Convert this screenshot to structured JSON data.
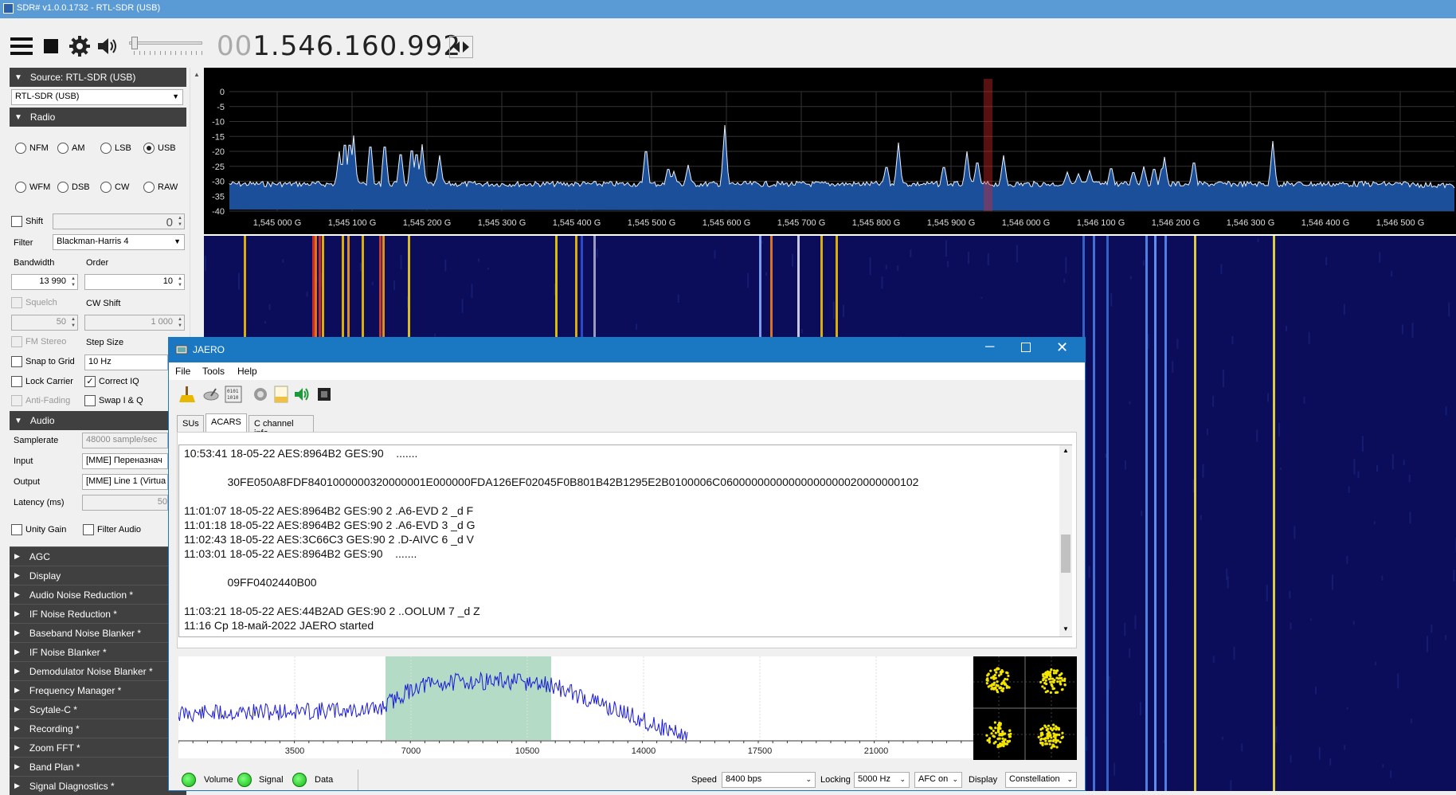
{
  "titlebar": {
    "title": "SDR# v1.0.0.1732 - RTL-SDR (USB)"
  },
  "toolbar": {
    "freq_dim": "00",
    "freq_main": "1.546.160.992"
  },
  "source": {
    "header": "Source: RTL-SDR (USB)",
    "device": "RTL-SDR (USB)"
  },
  "radio": {
    "header": "Radio",
    "modes": [
      "NFM",
      "AM",
      "LSB",
      "USB",
      "WFM",
      "DSB",
      "CW",
      "RAW"
    ],
    "selected_mode": "USB",
    "shift_label": "Shift",
    "shift_value": "0",
    "filter_label": "Filter",
    "filter_value": "Blackman-Harris 4",
    "bandwidth_label": "Bandwidth",
    "bandwidth_value": "13 990",
    "order_label": "Order",
    "order_value": "10",
    "squelch_label": "Squelch",
    "squelch_value": "50",
    "cwshift_label": "CW Shift",
    "cwshift_value": "1 000",
    "fmstereo_label": "FM Stereo",
    "stepsize_label": "Step Size",
    "snap_label": "Snap to Grid",
    "step_value": "10 Hz",
    "lockcarrier_label": "Lock Carrier",
    "correctiq_label": "Correct IQ",
    "antifading_label": "Anti-Fading",
    "swapiq_label": "Swap I & Q"
  },
  "audio": {
    "header": "Audio",
    "samplerate_label": "Samplerate",
    "samplerate_value": "48000 sample/sec",
    "input_label": "Input",
    "input_value": "[MME] Переназнач",
    "output_label": "Output",
    "output_value": "[MME] Line 1 (Virtua",
    "latency_label": "Latency (ms)",
    "latency_value": "50",
    "unitygain_label": "Unity Gain",
    "filteraudio_label": "Filter Audio"
  },
  "plugins": [
    "AGC",
    "Display",
    "Audio Noise Reduction *",
    "IF Noise Reduction *",
    "Baseband Noise Blanker *",
    "IF Noise Blanker *",
    "Demodulator Noise Blanker *",
    "Frequency Manager *",
    "Scytale-C *",
    "Recording *",
    "Zoom FFT *",
    "Band Plan *",
    "Signal Diagnostics *"
  ],
  "spectrum": {
    "y_ticks": [
      "0",
      "-5",
      "-10",
      "-15",
      "-20",
      "-25",
      "-30",
      "-35",
      "-40"
    ],
    "x_ticks": [
      "1,545 000 G",
      "1,545 100 G",
      "1,545 200 G",
      "1,545 300 G",
      "1,545 400 G",
      "1,545 500 G",
      "1,545 600 G",
      "1,545 700 G",
      "1,545 800 G",
      "1,545 900 G",
      "1,546 000 G",
      "1,546 100 G",
      "1,546 200 G",
      "1,546 300 G",
      "1,546 400 G",
      "1,546 500 G"
    ]
  },
  "jaero": {
    "title": "JAERO",
    "menu": [
      "File",
      "Tools",
      "Help"
    ],
    "tabs": [
      "SUs",
      "ACARS",
      "C channel info"
    ],
    "selected_tab": "ACARS",
    "log": [
      "10:53:41 18-05-22 AES:8964B2 GES:90    .......",
      "",
      "              30FE050A8FDF8401000000320000001E000000FDA126EF02045F0B801B42B1295E2B0100006C06000000000000000000020000000102",
      "",
      "11:01:07 18-05-22 AES:8964B2 GES:90 2 .A6-EVD 2 _d F",
      "11:01:18 18-05-22 AES:8964B2 GES:90 2 .A6-EVD 3 _d G",
      "11:02:43 18-05-22 AES:3C66C3 GES:90 2 .D-AIVC 6 _d V",
      "11:03:01 18-05-22 AES:8964B2 GES:90    .......",
      "",
      "              09FF0402440B00",
      "",
      "11:03:21 18-05-22 AES:44B2AD GES:90 2 ..OOLUM 7 _d Z",
      "11:16 Ср 18-май-2022 JAERO started"
    ],
    "spec_ticks": [
      "3500",
      "7000",
      "10500",
      "14000",
      "17500",
      "21000"
    ],
    "status": {
      "volume": "Volume",
      "signal": "Signal",
      "data": "Data",
      "speed_label": "Speed",
      "speed_value": "8400 bps",
      "locking_label": "Locking",
      "locking_value": "5000 Hz",
      "afc_value": "AFC on",
      "display_label": "Display",
      "display_value": "Constellation"
    }
  }
}
